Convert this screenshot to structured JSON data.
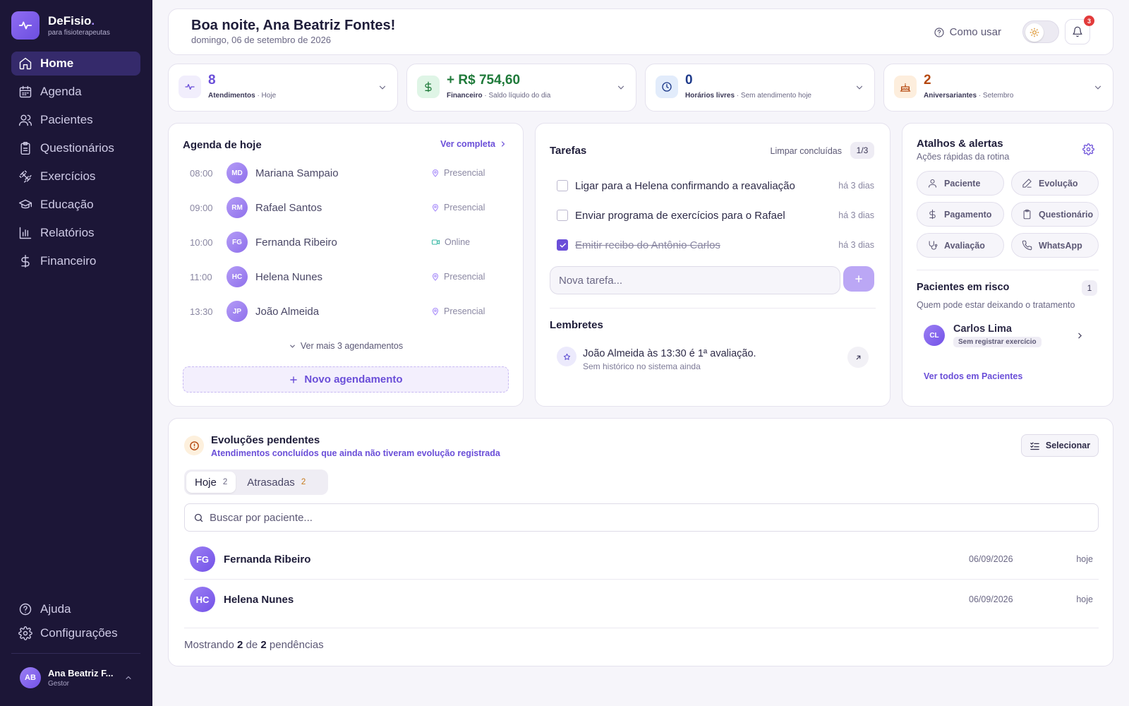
{
  "brand": {
    "name": "DeFisio",
    "dot": ".",
    "subtitle": "para fisioterapeutas"
  },
  "nav": {
    "items": [
      {
        "label": "Home",
        "icon": "home-icon"
      },
      {
        "label": "Agenda",
        "icon": "calendar-icon"
      },
      {
        "label": "Pacientes",
        "icon": "users-icon"
      },
      {
        "label": "Questionários",
        "icon": "clipboard-icon"
      },
      {
        "label": "Exercícios",
        "icon": "dumbbell-icon"
      },
      {
        "label": "Educação",
        "icon": "graduation-cap-icon"
      },
      {
        "label": "Relatórios",
        "icon": "bar-chart-icon"
      },
      {
        "label": "Financeiro",
        "icon": "dollar-icon"
      }
    ],
    "bottom": [
      {
        "label": "Ajuda",
        "icon": "help-circle-icon"
      },
      {
        "label": "Configurações",
        "icon": "gear-icon"
      }
    ]
  },
  "user": {
    "initials": "AB",
    "name": "Ana Beatriz F...",
    "role": "Gestor"
  },
  "header": {
    "greeting": "Boa noite, Ana Beatriz Fontes!",
    "date": "domingo, 06 de setembro de 2026",
    "help_label": "Como usar",
    "notification_count": "3"
  },
  "stats": [
    {
      "value": "8",
      "label": "Atendimentos",
      "detail": " · Hoje",
      "icon": "activity-icon",
      "color": "#6a4ed8",
      "bg": "#f1eefc"
    },
    {
      "value": "+ R$ 754,60",
      "label": "Financeiro",
      "detail": " · Saldo líquido do dia",
      "icon": "dollar-icon",
      "color": "#1f7a3a",
      "bg": "#dff5e6"
    },
    {
      "value": "0",
      "label": "Horários livres",
      "detail": " · Sem atendimento hoje",
      "icon": "clock-icon",
      "color": "#1e3a8a",
      "bg": "#e2ecfb"
    },
    {
      "value": "2",
      "label": "Aniversariantes",
      "detail": " · Setembro",
      "icon": "cake-icon",
      "color": "#b5480f",
      "bg": "#fdeedd"
    }
  ],
  "agenda": {
    "title": "Agenda de hoje",
    "link": "Ver completa",
    "items": [
      {
        "time": "08:00",
        "initials": "MD",
        "name": "Mariana Sampaio",
        "mode": "Presencial"
      },
      {
        "time": "09:00",
        "initials": "RM",
        "name": "Rafael Santos",
        "mode": "Presencial"
      },
      {
        "time": "10:00",
        "initials": "FG",
        "name": "Fernanda Ribeiro",
        "mode": "Online"
      },
      {
        "time": "11:00",
        "initials": "HC",
        "name": "Helena Nunes",
        "mode": "Presencial"
      },
      {
        "time": "13:30",
        "initials": "JP",
        "name": "João Almeida",
        "mode": "Presencial"
      }
    ],
    "more": "Ver mais 3 agendamentos",
    "new": "Novo agendamento"
  },
  "tasks": {
    "title": "Tarefas",
    "clear": "Limpar concluídas",
    "count": "1/3",
    "items": [
      {
        "text": "Ligar para a Helena confirmando a reavaliação",
        "ago": "há 3 dias",
        "done": false
      },
      {
        "text": "Enviar programa de exercícios para o Rafael",
        "ago": "há 3 dias",
        "done": false
      },
      {
        "text": "Emitir recibo do Antônio Carlos",
        "ago": "há 3 dias",
        "done": true
      }
    ],
    "placeholder": "Nova tarefa...",
    "reminders_title": "Lembretes",
    "reminder": {
      "text": "João Almeida às 13:30 é 1ª avaliação.",
      "sub": "Sem histórico no sistema ainda"
    }
  },
  "shortcuts": {
    "title": "Atalhos & alertas",
    "subtitle": "Ações rápidas da rotina",
    "buttons": [
      {
        "label": "Paciente",
        "icon": "user-icon"
      },
      {
        "label": "Evolução",
        "icon": "pencil-icon"
      },
      {
        "label": "Pagamento",
        "icon": "dollar-icon"
      },
      {
        "label": "Questionário",
        "icon": "clipboard-icon"
      },
      {
        "label": "Avaliação",
        "icon": "stethoscope-icon"
      },
      {
        "label": "WhatsApp",
        "icon": "phone-icon"
      }
    ],
    "risk_title": "Pacientes em risco",
    "risk_count": "1",
    "risk_subtitle": "Quem pode estar deixando o tratamento",
    "risk_patient": {
      "initials": "CL",
      "name": "Carlos Lima",
      "tag": "Sem registrar exercício"
    },
    "risk_link": "Ver todos em Pacientes"
  },
  "pending": {
    "title": "Evoluções pendentes",
    "subtitle": "Atendimentos concluídos que ainda não tiveram evolução registrada",
    "select": "Selecionar",
    "tabs": [
      {
        "label": "Hoje",
        "count": "2"
      },
      {
        "label": "Atrasadas",
        "count": "2"
      }
    ],
    "search_placeholder": "Buscar por paciente...",
    "rows": [
      {
        "initials": "FG",
        "name": "Fernanda Ribeiro",
        "date": "06/09/2026",
        "when": "hoje"
      },
      {
        "initials": "HC",
        "name": "Helena Nunes",
        "date": "06/09/2026",
        "when": "hoje"
      }
    ],
    "footer": {
      "prefix": "Mostrando ",
      "shown": "2",
      "mid": " de ",
      "total": "2",
      "suffix": " pendências"
    }
  }
}
